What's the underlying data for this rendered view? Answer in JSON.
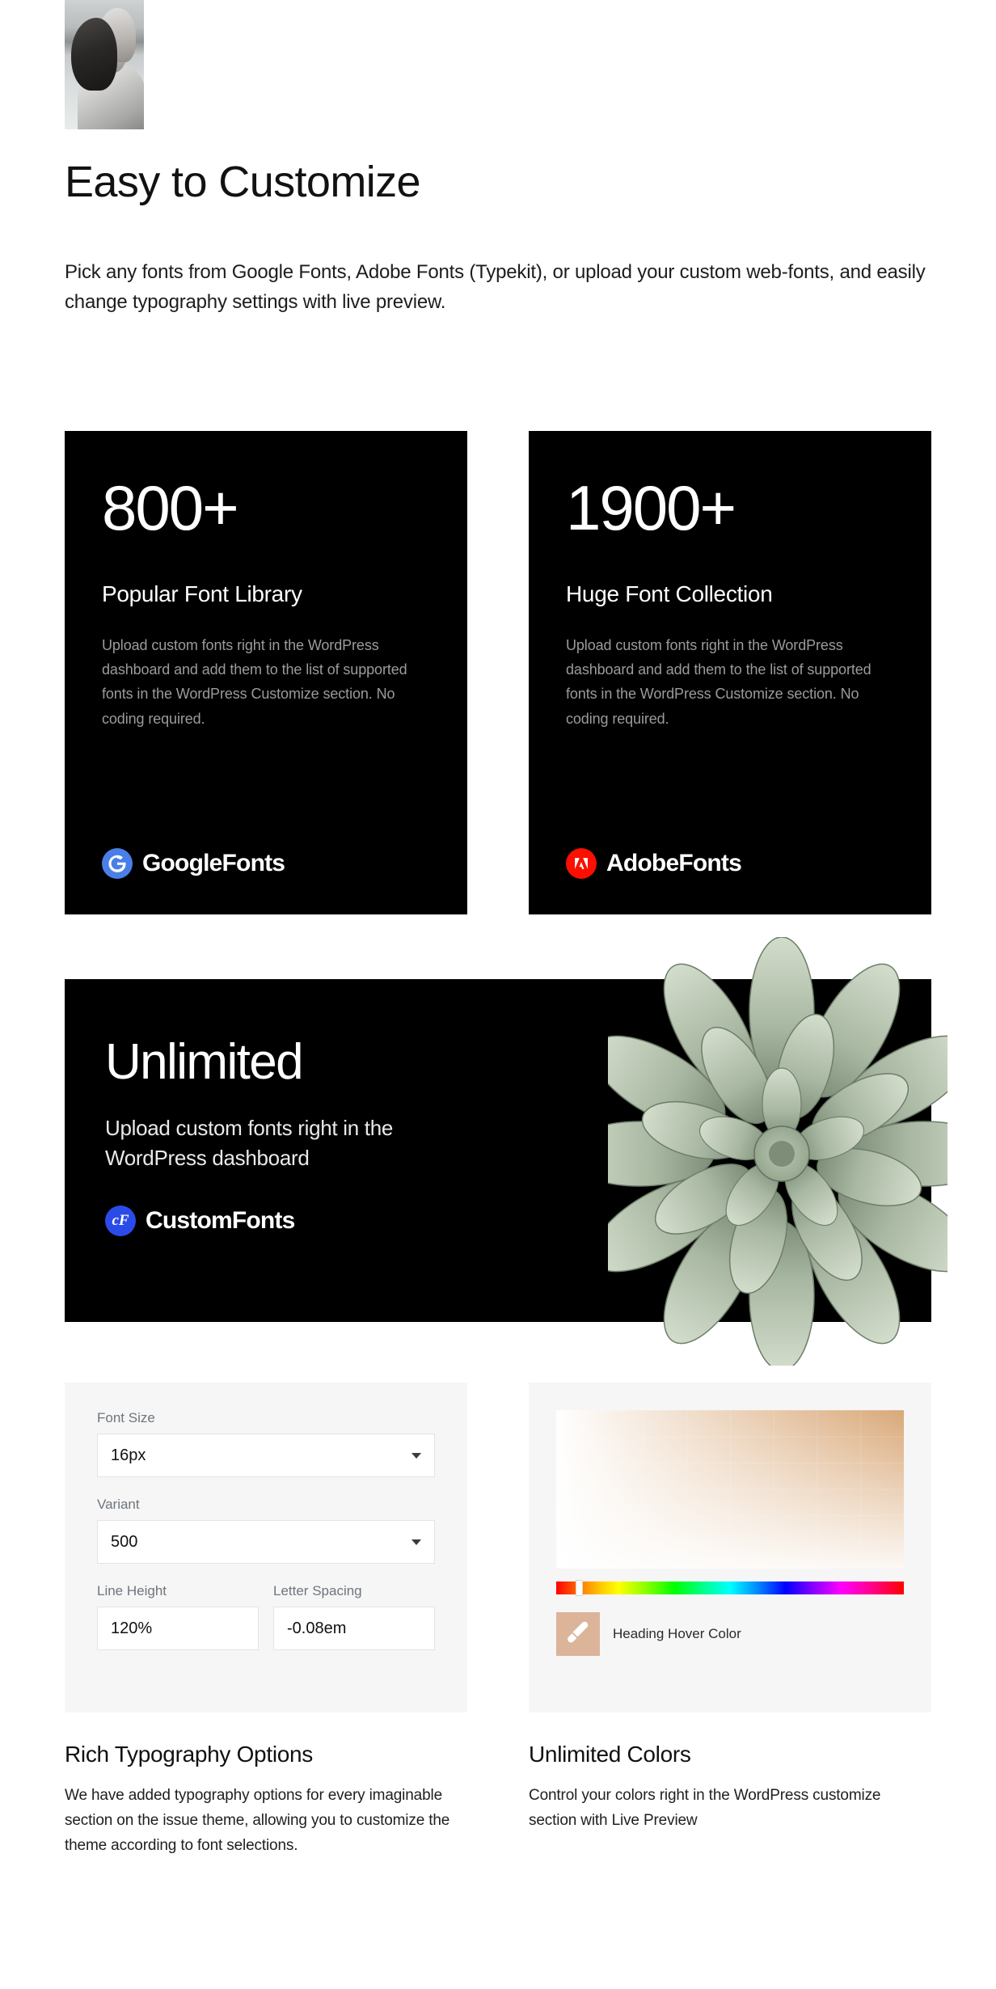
{
  "hero": {
    "image_alt": "black-and-white portrait of a woman in a puffy jacket",
    "title": "Easy to Customize",
    "lede": "Pick any fonts from Google Fonts, Adobe Fonts (Typekit), or upload your custom web-fonts, and easily change typography settings with live preview."
  },
  "stat_cards": [
    {
      "number": "800+",
      "heading": "Popular Font Library",
      "body": "Upload custom fonts right in the WordPress dashboard and add them to the list of supported fonts in the WordPress Customize section. No coding required.",
      "brand_name": "GoogleFonts",
      "brand_mark": "G",
      "brand_color": "#4a7fe8",
      "icon": "google-g-icon"
    },
    {
      "number": "1900+",
      "heading": "Huge Font Collection",
      "body": "Upload custom fonts right in the WordPress dashboard and add them to the list of supported fonts in the WordPress Customize section. No coding required.",
      "brand_name": "AdobeFonts",
      "brand_mark": "A",
      "brand_color": "#fa0f00",
      "icon": "adobe-a-icon"
    }
  ],
  "banner": {
    "heading": "Unlimited",
    "body": "Upload custom fonts right in the WordPress dashboard",
    "brand_name": "CustomFonts",
    "brand_mark": "cF",
    "brand_color": "#2b4be8",
    "icon": "custom-fonts-icon",
    "image_alt": "succulent echeveria plant"
  },
  "typography_panel": {
    "fields": {
      "font_size": {
        "label": "Font Size",
        "value": "16px"
      },
      "variant": {
        "label": "Variant",
        "value": "500"
      },
      "line_height": {
        "label": "Line Height",
        "value": "120%"
      },
      "letter_spacing": {
        "label": "Letter Spacing",
        "value": "-0.08em"
      }
    },
    "title": "Rich Typography Options",
    "description": "We have added typography options for every imaginable section on the issue theme, allowing you to customize the theme according to font selections."
  },
  "color_panel": {
    "swatch_label": "Heading Hover Color",
    "swatch_color": "#dcb49a",
    "gradient_color": "#d9a878",
    "hue_handle_position": "5.5%",
    "brush_icon": "brush-icon",
    "title": "Unlimited Colors",
    "description": "Control your colors right in the WordPress customize section with Live Preview"
  }
}
